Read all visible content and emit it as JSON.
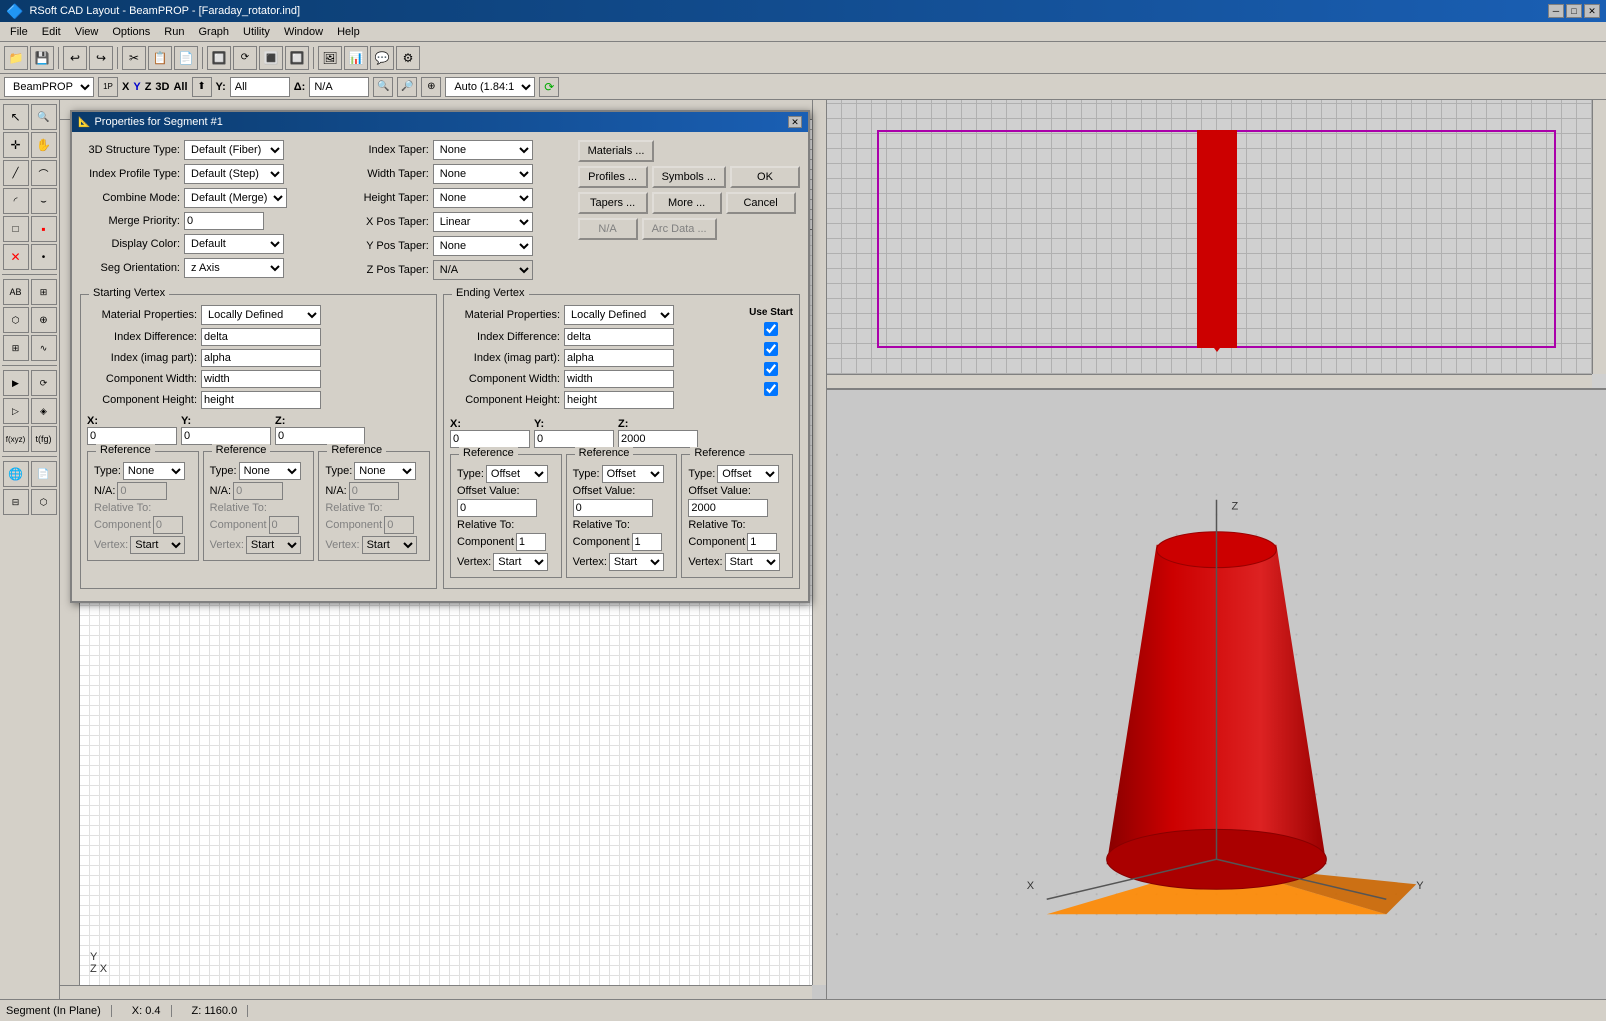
{
  "app": {
    "title": "RSoft CAD Layout - BeamPROP - [Faraday_rotator.ind]",
    "icon": "app-icon"
  },
  "titlebar": {
    "minimize": "─",
    "restore": "□",
    "close": "✕"
  },
  "menubar": {
    "items": [
      "File",
      "Edit",
      "View",
      "Options",
      "Run",
      "Graph",
      "Utility",
      "Window",
      "Help"
    ]
  },
  "toolbar": {
    "buttons": [
      "📁",
      "💾",
      "↩",
      "↪",
      "✂",
      "📋",
      "📄",
      "🔲",
      "↕",
      "⟳",
      "🔳",
      "🔲",
      "🖼",
      "📊",
      "💬",
      "⚙"
    ]
  },
  "addressbar": {
    "component_label": "BeamPROP",
    "x_label": "X",
    "y_label": "Y",
    "z_label": "Z",
    "d3_label": "3D",
    "all_label": "All",
    "y_value": "All",
    "delta_label": "Δ:",
    "delta_value": "N/A",
    "zoom_value": "Auto (1.84:1)"
  },
  "dialog": {
    "title": "Properties for Segment #1",
    "structure_type_label": "3D Structure Type:",
    "structure_type_value": "Default (Fiber)",
    "index_profile_label": "Index Profile Type:",
    "index_profile_value": "Default (Step)",
    "combine_mode_label": "Combine Mode:",
    "combine_mode_value": "Default (Merge)",
    "merge_priority_label": "Merge Priority:",
    "merge_priority_value": "0",
    "display_color_label": "Display Color:",
    "display_color_value": "Default",
    "seg_orientation_label": "Seg Orientation:",
    "seg_orientation_value": "z Axis",
    "index_taper_label": "Index Taper:",
    "index_taper_value": "None",
    "width_taper_label": "Width Taper:",
    "width_taper_value": "None",
    "height_taper_label": "Height Taper:",
    "height_taper_value": "None",
    "xpos_taper_label": "X Pos Taper:",
    "xpos_taper_value": "Linear",
    "ypos_taper_label": "Y Pos Taper:",
    "ypos_taper_value": "None",
    "zpos_taper_label": "Z Pos Taper:",
    "zpos_taper_value": "N/A",
    "buttons": {
      "materials": "Materials ...",
      "profiles": "Profiles ...",
      "symbols": "Symbols ...",
      "ok": "OK",
      "tapers": "Tapers ...",
      "more": "More ...",
      "cancel": "Cancel",
      "na": "N/A",
      "arc_data": "Arc Data ..."
    },
    "starting_vertex": {
      "title": "Starting Vertex",
      "mat_props_label": "Material Properties:",
      "mat_props_value": "Locally Defined",
      "index_diff_label": "Index Difference:",
      "index_diff_value": "delta",
      "index_imag_label": "Index (imag part):",
      "index_imag_value": "alpha",
      "comp_width_label": "Component Width:",
      "comp_width_value": "width",
      "comp_height_label": "Component Height:",
      "comp_height_value": "height",
      "x_label": "X:",
      "x_value": "0",
      "y_label": "Y:",
      "y_value": "0",
      "z_label": "Z:",
      "z_value": "0",
      "ref_x": {
        "title": "Reference",
        "type_label": "Type:",
        "type_value": "None",
        "na_label": "N/A:",
        "na_value": "0",
        "rel_label": "Relative To:",
        "component_label": "Component",
        "component_value": "0",
        "vertex_label": "Vertex:",
        "vertex_value": "Start"
      },
      "ref_y": {
        "title": "Reference",
        "type_label": "Type:",
        "type_value": "None",
        "na_label": "N/A:",
        "na_value": "0",
        "rel_label": "Relative To:",
        "component_label": "Component",
        "component_value": "0",
        "vertex_label": "Vertex:",
        "vertex_value": "Start"
      },
      "ref_z": {
        "title": "Reference",
        "type_label": "Type:",
        "type_value": "None",
        "na_label": "N/A:",
        "na_value": "0",
        "rel_label": "Relative To:",
        "component_label": "Component",
        "component_value": "0",
        "vertex_label": "Vertex:",
        "vertex_value": "Start"
      }
    },
    "ending_vertex": {
      "title": "Ending Vertex",
      "mat_props_label": "Material Properties:",
      "mat_props_value": "Locally Defined",
      "index_diff_label": "Index Difference:",
      "index_diff_value": "delta",
      "index_imag_label": "Index (imag part):",
      "index_imag_value": "alpha",
      "comp_width_label": "Component Width:",
      "comp_width_value": "width",
      "comp_height_label": "Component Height:",
      "comp_height_value": "height",
      "use_start_label": "Use Start",
      "use_start_checks": [
        true,
        true,
        true,
        true
      ],
      "x_label": "X:",
      "x_value": "0",
      "y_label": "Y:",
      "y_value": "0",
      "z_label": "Z:",
      "z_value": "2000",
      "ref_x": {
        "title": "Reference",
        "type_label": "Type:",
        "type_value": "Offset",
        "offset_label": "Offset Value:",
        "offset_value": "0",
        "rel_label": "Relative To:",
        "component_label": "Component",
        "component_value": "1",
        "vertex_label": "Vertex:",
        "vertex_value": "Start"
      },
      "ref_y": {
        "title": "Reference",
        "type_label": "Type:",
        "type_value": "Offset",
        "offset_label": "Offset Value:",
        "offset_value": "0",
        "rel_label": "Relative To:",
        "component_label": "Component",
        "component_value": "1",
        "vertex_label": "Vertex:",
        "vertex_value": "Start"
      },
      "ref_z": {
        "title": "Reference",
        "type_label": "Type:",
        "type_value": "Offset",
        "offset_label": "Offset Value:",
        "offset_value": "2000",
        "rel_label": "Relative To:",
        "component_label": "Component",
        "component_value": "1",
        "vertex_label": "Vertex:",
        "vertex_value": "Start"
      }
    }
  },
  "statusbar": {
    "segment_label": "Segment (In Plane)",
    "x_coord": "X: 0.4",
    "z_coord": "Z: 1160.0"
  },
  "canvas": {
    "bg_color": "#ffffff",
    "grid_color": "#d0d0d0"
  },
  "render3d": {
    "shape": "cylinder_tapered",
    "color_main": "#cc0000",
    "color_base": "#ff8800",
    "axis_x": "X",
    "axis_y": "Y",
    "axis_z": "Z"
  }
}
